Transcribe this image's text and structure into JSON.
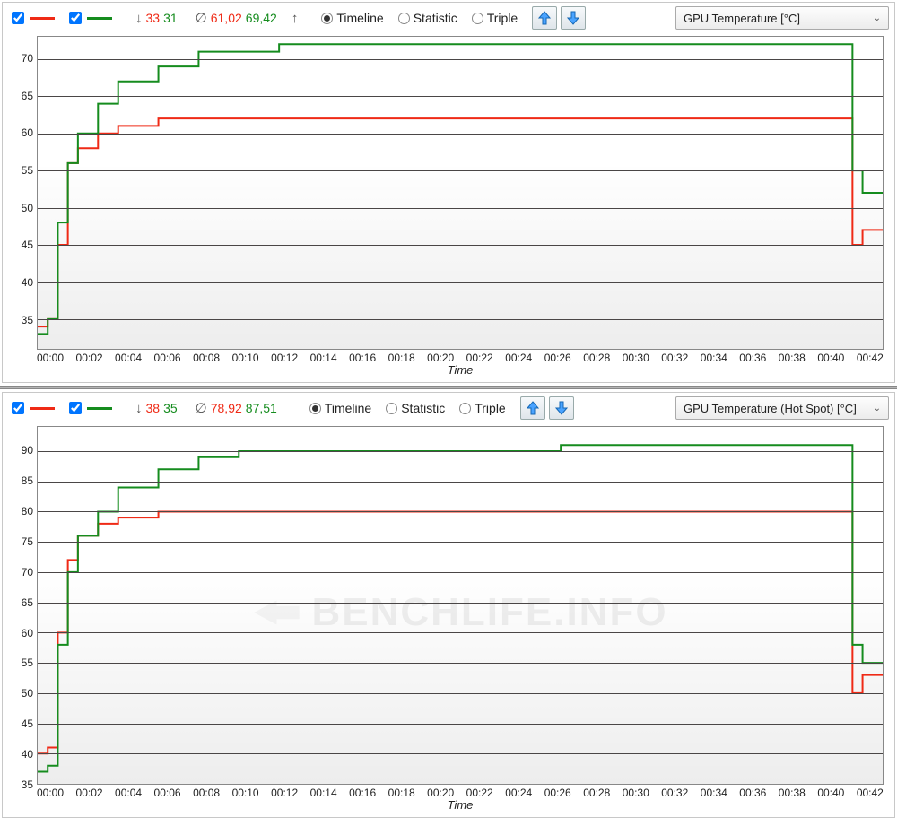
{
  "watermark": "BENCHLIFE.INFO",
  "charts": [
    {
      "dropdown": "GPU Temperature [°C]",
      "min": {
        "sym": "↓",
        "red": "33",
        "green": "31"
      },
      "avg": {
        "sym": "∅",
        "red": "61,02",
        "green": "69,42"
      },
      "updown_sym": "↑",
      "views": {
        "timeline": "Timeline",
        "statistic": "Statistic",
        "triple": "Triple",
        "selected": "timeline"
      },
      "xlabel": "Time",
      "yticks": [
        35,
        40,
        45,
        50,
        55,
        60,
        65,
        70
      ],
      "xticks": [
        "00:00",
        "00:02",
        "00:04",
        "00:06",
        "00:08",
        "00:10",
        "00:12",
        "00:14",
        "00:16",
        "00:18",
        "00:20",
        "00:22",
        "00:24",
        "00:26",
        "00:28",
        "00:30",
        "00:32",
        "00:34",
        "00:36",
        "00:38",
        "00:40",
        "00:42"
      ]
    },
    {
      "dropdown": "GPU Temperature (Hot Spot) [°C]",
      "min": {
        "sym": "↓",
        "red": "38",
        "green": "35"
      },
      "avg": {
        "sym": "∅",
        "red": "78,92",
        "green": "87,51"
      },
      "views": {
        "timeline": "Timeline",
        "statistic": "Statistic",
        "triple": "Triple",
        "selected": "timeline"
      },
      "xlabel": "Time",
      "yticks": [
        35,
        40,
        45,
        50,
        55,
        60,
        65,
        70,
        75,
        80,
        85,
        90
      ],
      "xticks": [
        "00:00",
        "00:02",
        "00:04",
        "00:06",
        "00:08",
        "00:10",
        "00:12",
        "00:14",
        "00:16",
        "00:18",
        "00:20",
        "00:22",
        "00:24",
        "00:26",
        "00:28",
        "00:30",
        "00:32",
        "00:34",
        "00:36",
        "00:38",
        "00:40",
        "00:42"
      ]
    }
  ],
  "chart_data": [
    {
      "type": "line",
      "title": "GPU Temperature [°C]",
      "xlabel": "Time",
      "ylabel": "",
      "ylim": [
        31,
        73
      ],
      "x_minutes": [
        0,
        0.5,
        1,
        1.5,
        2,
        3,
        4,
        6,
        8,
        10,
        12,
        14,
        26,
        38,
        40,
        40.5,
        41,
        42
      ],
      "series": [
        {
          "name": "red",
          "color": "#ef2a16",
          "values": [
            34,
            35,
            45,
            56,
            58,
            60,
            61,
            62,
            62,
            62,
            62,
            62,
            62,
            62,
            62,
            45,
            47,
            47
          ]
        },
        {
          "name": "green",
          "color": "#158c1e",
          "values": [
            33,
            35,
            48,
            56,
            60,
            64,
            67,
            69,
            71,
            71,
            72,
            72,
            72,
            72,
            72,
            55,
            52,
            52
          ]
        }
      ],
      "xticks": [
        "00:00",
        "00:02",
        "00:04",
        "00:06",
        "00:08",
        "00:10",
        "00:12",
        "00:14",
        "00:16",
        "00:18",
        "00:20",
        "00:22",
        "00:24",
        "00:26",
        "00:28",
        "00:30",
        "00:32",
        "00:34",
        "00:36",
        "00:38",
        "00:40",
        "00:42"
      ]
    },
    {
      "type": "line",
      "title": "GPU Temperature (Hot Spot) [°C]",
      "xlabel": "Time",
      "ylabel": "",
      "ylim": [
        35,
        94
      ],
      "x_minutes": [
        0,
        0.5,
        1,
        1.5,
        2,
        3,
        4,
        6,
        8,
        10,
        12,
        14,
        26,
        38,
        40,
        40.5,
        41,
        42
      ],
      "series": [
        {
          "name": "red",
          "color": "#ef2a16",
          "values": [
            40,
            41,
            60,
            72,
            76,
            78,
            79,
            80,
            80,
            80,
            80,
            80,
            80,
            80,
            80,
            50,
            53,
            53
          ]
        },
        {
          "name": "green",
          "color": "#158c1e",
          "values": [
            37,
            38,
            58,
            70,
            76,
            80,
            84,
            87,
            89,
            90,
            90,
            90,
            91,
            91,
            91,
            58,
            55,
            55
          ]
        }
      ],
      "xticks": [
        "00:00",
        "00:02",
        "00:04",
        "00:06",
        "00:08",
        "00:10",
        "00:12",
        "00:14",
        "00:16",
        "00:18",
        "00:20",
        "00:22",
        "00:24",
        "00:26",
        "00:28",
        "00:30",
        "00:32",
        "00:34",
        "00:36",
        "00:38",
        "00:40",
        "00:42"
      ]
    }
  ]
}
